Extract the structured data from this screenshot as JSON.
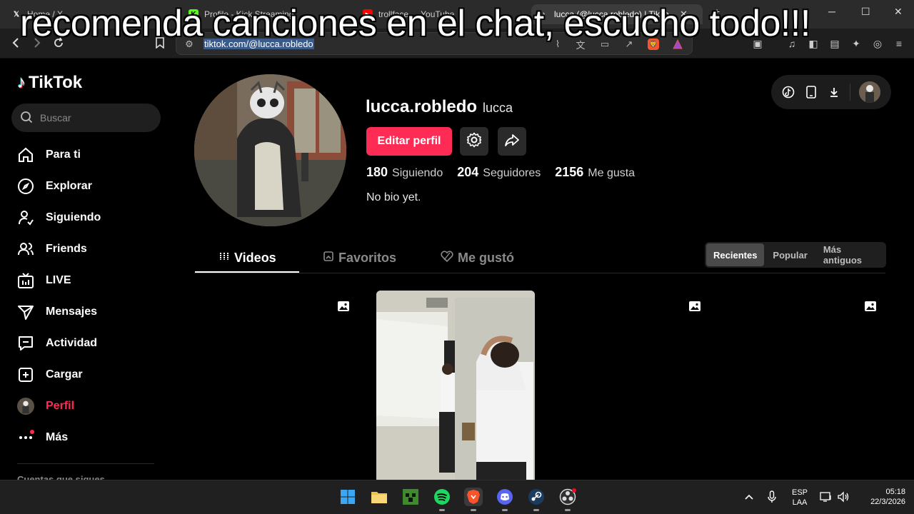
{
  "overlay": {
    "caption": "recomenda canciones en el chat, escucho todo!!!"
  },
  "browser": {
    "tabs": [
      {
        "title": "Home / X",
        "icon": "x-logo-icon"
      },
      {
        "title": "Profile - Kick Streaming",
        "icon": "kick-logo-icon"
      },
      {
        "title": "trollface_ - YouTube",
        "icon": "youtube-logo-icon"
      },
      {
        "title": "lucca (@lucca.robledo) | TikTok",
        "icon": "tiktok-logo-icon"
      }
    ],
    "url": "tiktok.com/@lucca.robledo",
    "brave_badge": "4"
  },
  "sidebar": {
    "logo": "TikTok",
    "search_placeholder": "Buscar",
    "items": [
      {
        "label": "Para ti",
        "icon": "home-icon"
      },
      {
        "label": "Explorar",
        "icon": "compass-icon"
      },
      {
        "label": "Siguiendo",
        "icon": "user-follow-icon"
      },
      {
        "label": "Friends",
        "icon": "friends-icon"
      },
      {
        "label": "LIVE",
        "icon": "live-tv-icon"
      },
      {
        "label": "Mensajes",
        "icon": "send-icon"
      },
      {
        "label": "Actividad",
        "icon": "activity-icon"
      },
      {
        "label": "Cargar",
        "icon": "upload-plus-icon"
      },
      {
        "label": "Perfil",
        "icon": "profile-avatar"
      },
      {
        "label": "Más",
        "icon": "more-dots-icon"
      }
    ],
    "following_accounts": "Cuentas que sigues"
  },
  "profile": {
    "username": "lucca.robledo",
    "nickname": "lucca",
    "edit_label": "Editar perfil",
    "stats": [
      {
        "value": "180",
        "label": "Siguiendo"
      },
      {
        "value": "204",
        "label": "Seguidores"
      },
      {
        "value": "2156",
        "label": "Me gusta"
      }
    ],
    "bio": "No bio yet."
  },
  "content_tabs": [
    {
      "label": "Videos",
      "icon": "grid-icon"
    },
    {
      "label": "Favoritos",
      "icon": "bookmark-icon"
    },
    {
      "label": "Me gustó",
      "icon": "heart-icon"
    }
  ],
  "sort": [
    {
      "label": "Recientes",
      "active": true
    },
    {
      "label": "Popular",
      "active": false
    },
    {
      "label": "Más antiguos",
      "active": false
    }
  ],
  "taskbar": {
    "lang": "ESP",
    "layout": "LAA",
    "time": "05:18",
    "date": "22/3/2026"
  },
  "colors": {
    "accent": "#fe2c55",
    "background": "#000000"
  }
}
